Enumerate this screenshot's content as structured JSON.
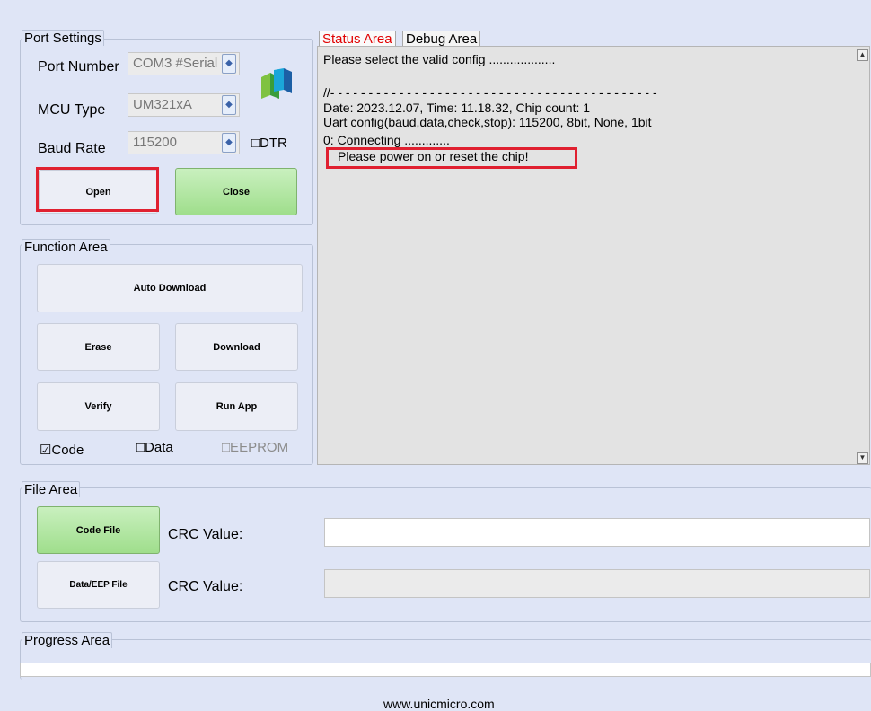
{
  "port_settings": {
    "title": "Port Settings",
    "port_number_label": "Port Number",
    "port_number_value": "COM3 #Serial",
    "mcu_type_label": "MCU Type",
    "mcu_type_value": "UM321xA",
    "baud_rate_label": "Baud Rate",
    "baud_rate_value": "115200",
    "dtr_label": "□DTR",
    "open_label": "Open",
    "close_label": "Close"
  },
  "function_area": {
    "title": "Function Area",
    "auto_download_label": "Auto Download",
    "erase_label": "Erase",
    "download_label": "Download",
    "verify_label": "Verify",
    "run_app_label": "Run App",
    "code_check_label": "☑Code",
    "data_check_label": "□Data",
    "eeprom_check_label": "□EEPROM"
  },
  "tabs": {
    "status_label": "Status Area",
    "debug_label": "Debug Area"
  },
  "status": {
    "line1": "Please select the valid config ...................",
    "line2": "//- - - - - - - - - - - - - - - - - - - - - - - - - - - - - - - - - - - - - - - - - - -",
    "line3": "Date: 2023.12.07, Time: 11.18.32, Chip count: 1",
    "line4": "Uart config(baud,data,check,stop): 115200, 8bit, None, 1bit",
    "line5": "0: Connecting .............",
    "line6": "Please power on or reset the chip!"
  },
  "file_area": {
    "title": "File Area",
    "code_file_label": "Code File",
    "code_crc_label": "CRC Value:",
    "code_crc_value": "",
    "data_file_label": "Data/EEP File",
    "data_crc_label": "CRC Value:",
    "data_crc_value": ""
  },
  "progress_area": {
    "title": "Progress Area",
    "progress": 0
  },
  "footer": {
    "url": "www.unicmicro.com"
  },
  "colors": {
    "background": "#dfe5f6",
    "highlight_red": "#e02030",
    "tab_active_text": "#e00000",
    "green_button": "#a8e394"
  }
}
